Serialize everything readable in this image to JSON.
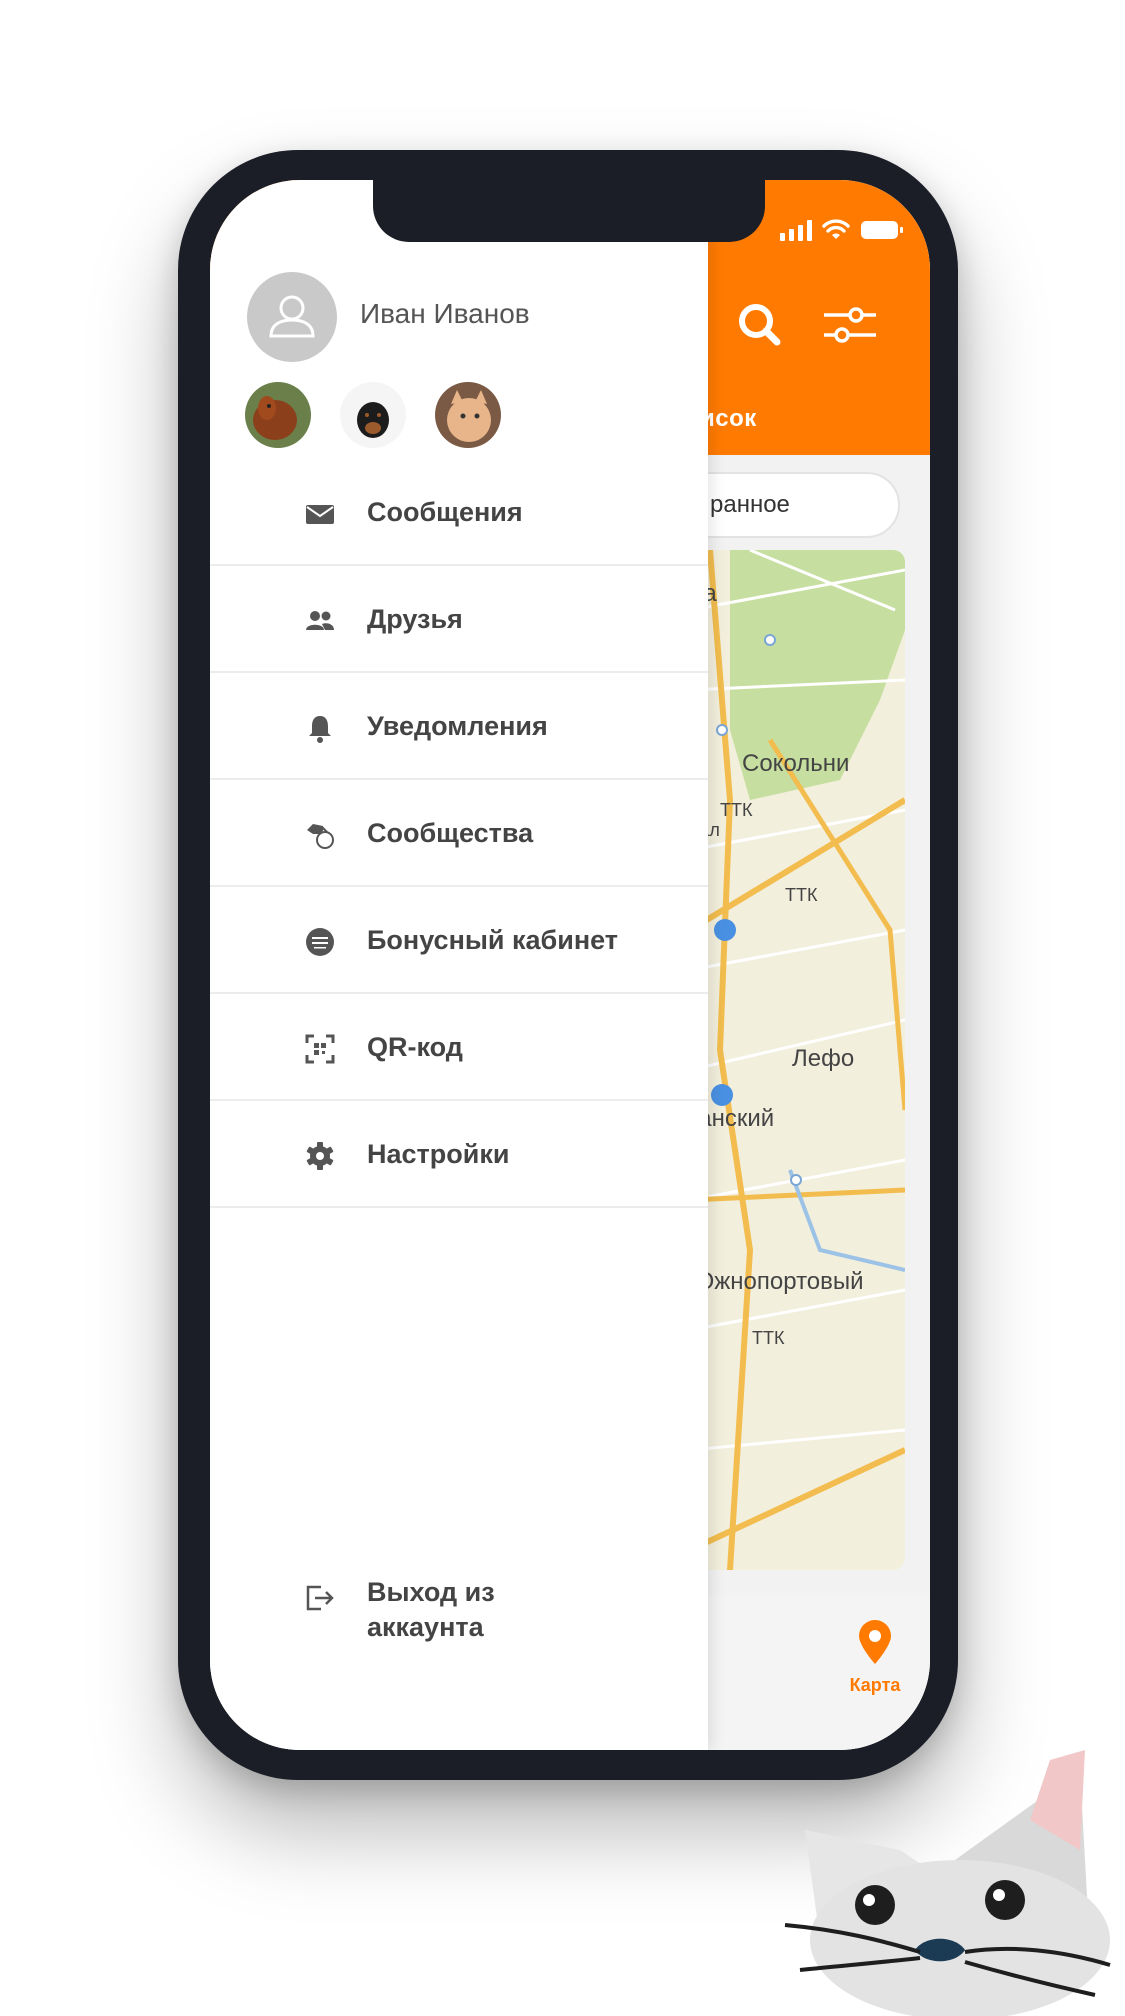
{
  "status_bar": {
    "signal": "signal-icon",
    "wifi": "wifi-icon",
    "battery": "battery-icon"
  },
  "header": {
    "search_icon": "search-icon",
    "filter_icon": "sliders-icon",
    "tab_partial": "исок",
    "favorites_partial": "ранное"
  },
  "map": {
    "labels": [
      "ра",
      "Сокольни",
      "ТТК",
      "вал",
      "ТТК",
      "Лефо",
      "ганский",
      "л",
      "Южнопортовый",
      "ТТК"
    ]
  },
  "bottom_nav": {
    "map_tab": "Карта"
  },
  "drawer": {
    "user": {
      "name": "Иван Иванов"
    },
    "pets": [
      "pet-dachshund",
      "pet-rottweiler-puppy",
      "pet-cat"
    ],
    "menu": [
      {
        "label": "Сообщения",
        "icon": "envelope-icon"
      },
      {
        "label": "Друзья",
        "icon": "people-icon"
      },
      {
        "label": "Уведомления",
        "icon": "bell-icon"
      },
      {
        "label": "Сообщества",
        "icon": "pets-community-icon"
      },
      {
        "label": "Бонусный кабинет",
        "icon": "bonus-coin-icon"
      },
      {
        "label": "QR-код",
        "icon": "qr-code-icon"
      },
      {
        "label": "Настройки",
        "icon": "gear-icon"
      }
    ],
    "logout": {
      "label": "Выход из аккаунта",
      "icon": "logout-icon"
    }
  },
  "colors": {
    "accent": "#ff7a00",
    "frame": "#1b1e27",
    "text": "#444444"
  }
}
